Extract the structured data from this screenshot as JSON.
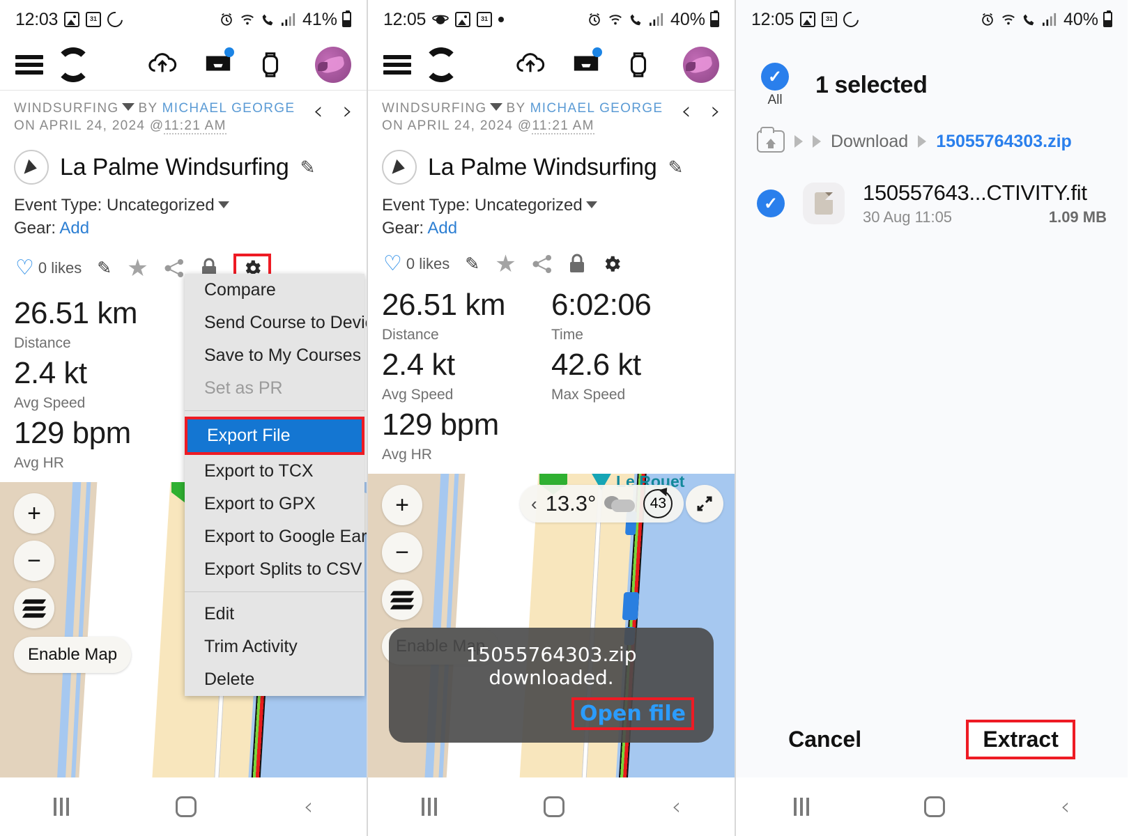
{
  "panel1": {
    "status": {
      "time": "12:03",
      "battery": "41%",
      "left_icons": [
        "photos-icon",
        "calendar-icon",
        "sync-icon"
      ],
      "right_icons": [
        "alarm-icon",
        "wifi-icon",
        "call-icon",
        "signal-icon",
        "battery-icon"
      ]
    },
    "appbar": {
      "menu": "hamburger-icon",
      "logo": "c-logo",
      "icons": [
        "cloud-upload-icon",
        "inbox-icon",
        "watch-icon",
        "avatar"
      ]
    },
    "meta": {
      "sport": "WINDSURFING",
      "by": "BY",
      "author": "MICHAEL GEORGE",
      "on": "ON",
      "date": "APRIL 24, 2024 @",
      "time": "11:21 AM"
    },
    "activity": {
      "title": "La Palme Windsurfing",
      "edit": "pencil-icon"
    },
    "event_type_label": "Event Type:",
    "event_type_value": "Uncategorized",
    "gear_label": "Gear:",
    "gear_value": "Add",
    "actions": {
      "likes": "0 likes"
    },
    "stats": [
      {
        "value": "26.51 km",
        "label": "Distance"
      },
      {
        "value": "2.4 kt",
        "label": "Avg Speed"
      },
      {
        "value": "129 bpm",
        "label": "Avg HR"
      }
    ],
    "map": {
      "enable_map": "Enable Map",
      "zoom_in": "+",
      "zoom_out": "−"
    },
    "menu": {
      "items": [
        {
          "label": "Compare",
          "state": "normal"
        },
        {
          "label": "Send Course to Device",
          "state": "normal"
        },
        {
          "label": "Save to My Courses",
          "state": "normal"
        },
        {
          "label": "Set as PR",
          "state": "disabled"
        },
        {
          "label": "Export File",
          "state": "selected"
        },
        {
          "label": "Export to TCX",
          "state": "normal"
        },
        {
          "label": "Export to GPX",
          "state": "normal"
        },
        {
          "label": "Export to Google Earth",
          "state": "normal"
        },
        {
          "label": "Export Splits to CSV",
          "state": "normal"
        },
        {
          "label": "Edit",
          "state": "normal"
        },
        {
          "label": "Trim Activity",
          "state": "normal"
        },
        {
          "label": "Delete",
          "state": "normal"
        }
      ]
    }
  },
  "panel2": {
    "status": {
      "time": "12:05",
      "battery": "40%"
    },
    "meta": {
      "sport": "WINDSURFING",
      "by": "BY",
      "author": "MICHAEL GEORGE",
      "on": "ON",
      "date": "APRIL 24, 2024 @",
      "time": "11:21 AM"
    },
    "activity": {
      "title": "La Palme Windsurfing"
    },
    "event_type_label": "Event Type:",
    "event_type_value": "Uncategorized",
    "gear_label": "Gear:",
    "gear_value": "Add",
    "actions": {
      "likes": "0 likes"
    },
    "stats_left": [
      {
        "value": "26.51 km",
        "label": "Distance"
      },
      {
        "value": "2.4 kt",
        "label": "Avg Speed"
      },
      {
        "value": "129 bpm",
        "label": "Avg HR"
      }
    ],
    "stats_right": [
      {
        "value": "6:02:06",
        "label": "Time"
      },
      {
        "value": "42.6 kt",
        "label": "Max Speed"
      }
    ],
    "map": {
      "enable_map": "Enable Map",
      "place_label": "Le Rouet",
      "temperature": "13.3°",
      "wind": "43",
      "weather": "cloudy-icon"
    },
    "toast": {
      "message": "15055764303.zip downloaded.",
      "action": "Open file"
    }
  },
  "panel3": {
    "status": {
      "time": "12:05",
      "battery": "40%"
    },
    "select_all_label": "All",
    "title": "1 selected",
    "breadcrumbs": [
      {
        "label": "home-folder-icon",
        "type": "icon"
      },
      {
        "label": "Download",
        "type": "text"
      },
      {
        "label": "15055764303.zip",
        "type": "active"
      }
    ],
    "file": {
      "name": "150557643...CTIVITY.fit",
      "date": "30 Aug 11:05",
      "size": "1.09 MB"
    },
    "buttons": {
      "cancel": "Cancel",
      "extract": "Extract"
    }
  },
  "colors": {
    "accent_blue": "#2a7fec",
    "highlight_red": "#ee1b24",
    "menu_selected": "#1476d2",
    "link_blue": "#2d7fd3",
    "sea": "#a6c8f0",
    "sand": "#f8e6bd",
    "land": "#e3d3bd"
  }
}
